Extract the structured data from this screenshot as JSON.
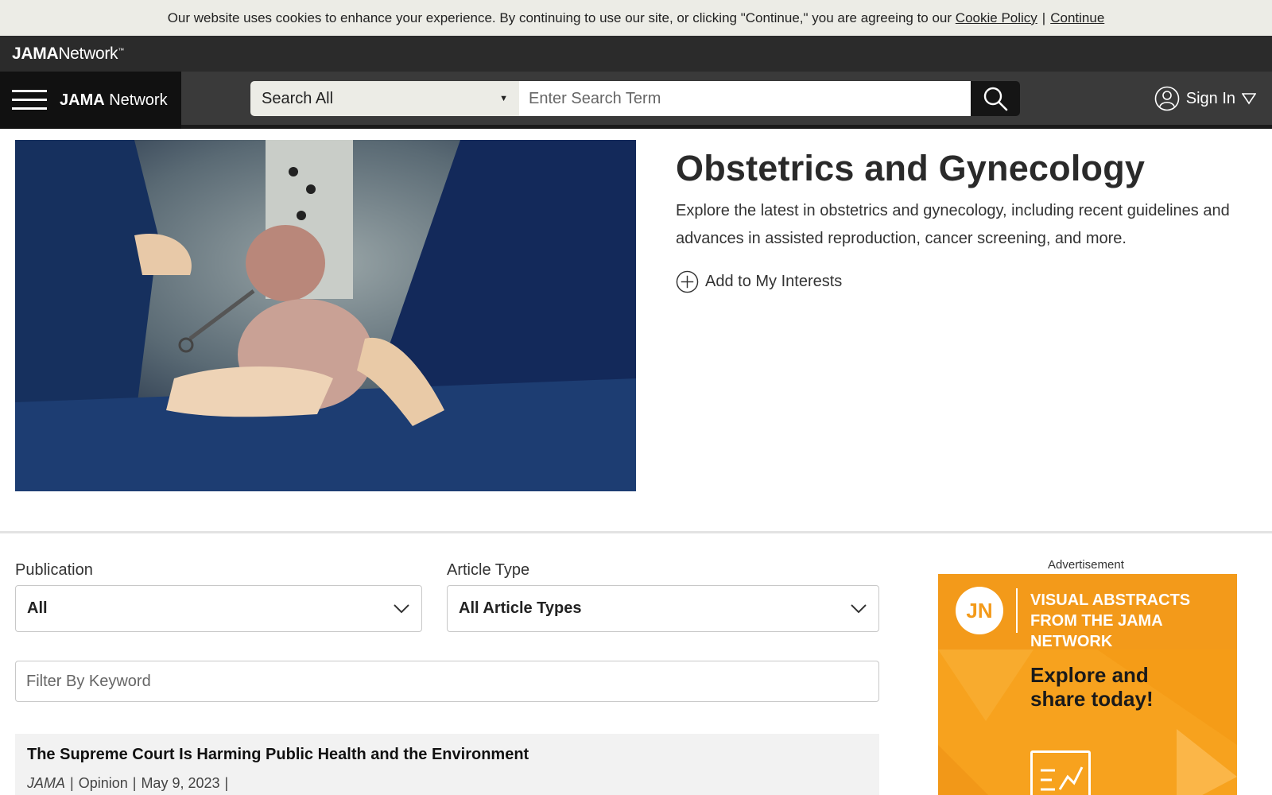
{
  "cookie_banner": {
    "text": "Our website uses cookies to enhance your experience. By continuing to use our site, or clicking \"Continue,\" you are agreeing to our",
    "policy_link": "Cookie Policy",
    "separator": "|",
    "continue_link": "Continue"
  },
  "network_bar": {
    "logo_bold": "JAMA",
    "logo_light": "Network",
    "logo_tm": "™"
  },
  "header": {
    "brand_bold": "JAMA",
    "brand_light": "Network",
    "search_scope": "Search All",
    "search_placeholder": "Enter Search Term",
    "signin_label": "Sign In"
  },
  "hero": {
    "title": "Obstetrics and Gynecology",
    "description": "Explore the latest in obstetrics and gynecology, including recent guidelines and advances in assisted reproduction, cancer screening, and more.",
    "add_interest": "Add to My Interests"
  },
  "filters": {
    "publication_label": "Publication",
    "publication_value": "All",
    "article_type_label": "Article Type",
    "article_type_value": "All Article Types",
    "keyword_placeholder": "Filter By Keyword"
  },
  "articles": [
    {
      "title": "The Supreme Court Is Harming Public Health and the Environment",
      "journal": "JAMA",
      "type": "Opinion",
      "date": "May 9, 2023",
      "sep": "|"
    }
  ],
  "advertisement": {
    "label": "Advertisement",
    "logo": "JN",
    "headline_1": "VISUAL ABSTRACTS",
    "headline_2": "FROM THE JAMA NETWORK",
    "cta_1": "Explore and",
    "cta_2": "share today!"
  },
  "colors": {
    "header_bg": "#3a3a3a",
    "cookie_bg": "#ecece6",
    "ad_orange": "#f7a21e"
  }
}
